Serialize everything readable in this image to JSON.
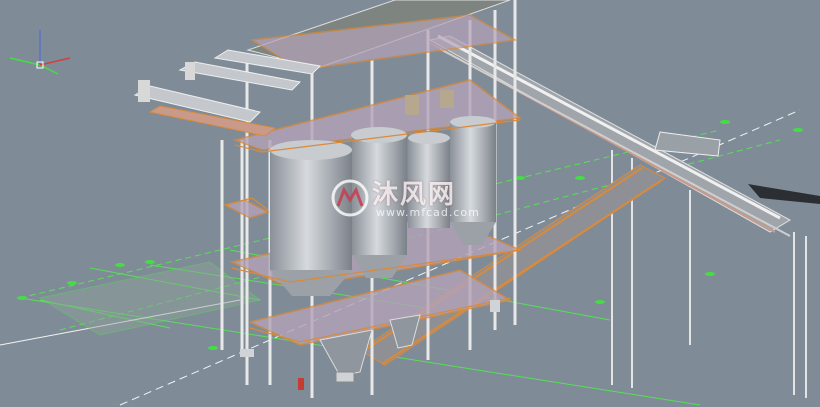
{
  "scene": {
    "background": "#7f8c98",
    "steel_color": "#e6e6e6",
    "handrail_color": "#d98a3a",
    "grid_color": "#55e055",
    "deck_color": "#b4a2b8",
    "silo_color": "#b9bec3",
    "roof_color": "#7e8480"
  },
  "watermark": {
    "title": "沐风网",
    "site": "www.mfcad.com",
    "logo": "mfcad-logo"
  },
  "axis_gizmo": {
    "icon": "ucs-axis-icon"
  }
}
